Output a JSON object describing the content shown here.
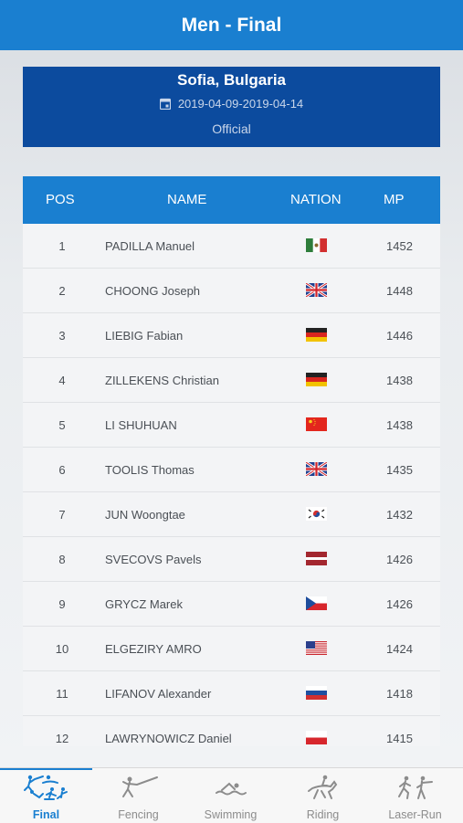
{
  "header": {
    "title": "Men - Final"
  },
  "event": {
    "location": "Sofia, Bulgaria",
    "dates": "2019-04-09-2019-04-14",
    "status": "Official"
  },
  "table": {
    "columns": {
      "pos": "POS",
      "name": "NAME",
      "nation": "NATION",
      "mp": "MP"
    },
    "rows": [
      {
        "pos": "1",
        "name": "PADILLA Manuel",
        "nation": "MEX",
        "mp": "1452"
      },
      {
        "pos": "2",
        "name": "CHOONG Joseph",
        "nation": "GBR",
        "mp": "1448"
      },
      {
        "pos": "3",
        "name": "LIEBIG Fabian",
        "nation": "GER",
        "mp": "1446"
      },
      {
        "pos": "4",
        "name": "ZILLEKENS Christian",
        "nation": "GER",
        "mp": "1438"
      },
      {
        "pos": "5",
        "name": "LI SHUHUAN",
        "nation": "CHN",
        "mp": "1438"
      },
      {
        "pos": "6",
        "name": "TOOLIS Thomas",
        "nation": "GBR",
        "mp": "1435"
      },
      {
        "pos": "7",
        "name": "JUN Woongtae",
        "nation": "KOR",
        "mp": "1432"
      },
      {
        "pos": "8",
        "name": "SVECOVS Pavels",
        "nation": "LAT",
        "mp": "1426"
      },
      {
        "pos": "9",
        "name": "GRYCZ Marek",
        "nation": "CZE",
        "mp": "1426"
      },
      {
        "pos": "10",
        "name": "ELGEZIRY AMRO",
        "nation": "USA",
        "mp": "1424"
      },
      {
        "pos": "11",
        "name": "LIFANOV Alexander",
        "nation": "RUS",
        "mp": "1418"
      },
      {
        "pos": "12",
        "name": "LAWRYNOWICZ Daniel",
        "nation": "POL",
        "mp": "1415"
      }
    ]
  },
  "tabs": [
    {
      "label": "Final",
      "icon": "final-icon",
      "active": true
    },
    {
      "label": "Fencing",
      "icon": "fencing-icon",
      "active": false
    },
    {
      "label": "Swimming",
      "icon": "swimming-icon",
      "active": false
    },
    {
      "label": "Riding",
      "icon": "riding-icon",
      "active": false
    },
    {
      "label": "Laser-Run",
      "icon": "laser-run-icon",
      "active": false
    }
  ],
  "colors": {
    "header_blue": "#1a7fd0",
    "event_card_blue": "#0c4b9e",
    "tab_active": "#1a7fd0",
    "tab_inactive": "#8c8c8c"
  }
}
